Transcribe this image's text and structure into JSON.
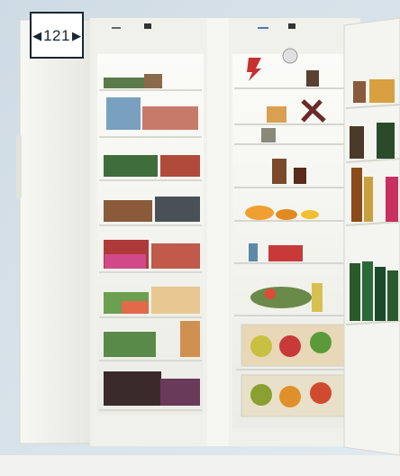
{
  "badge": {
    "page_number": "121",
    "prev_icon": "triangle-left",
    "next_icon": "triangle-right"
  },
  "colors": {
    "background": "#d6e2ea",
    "appliance": "#f3f3ef",
    "badge_border": "#1b2532"
  }
}
